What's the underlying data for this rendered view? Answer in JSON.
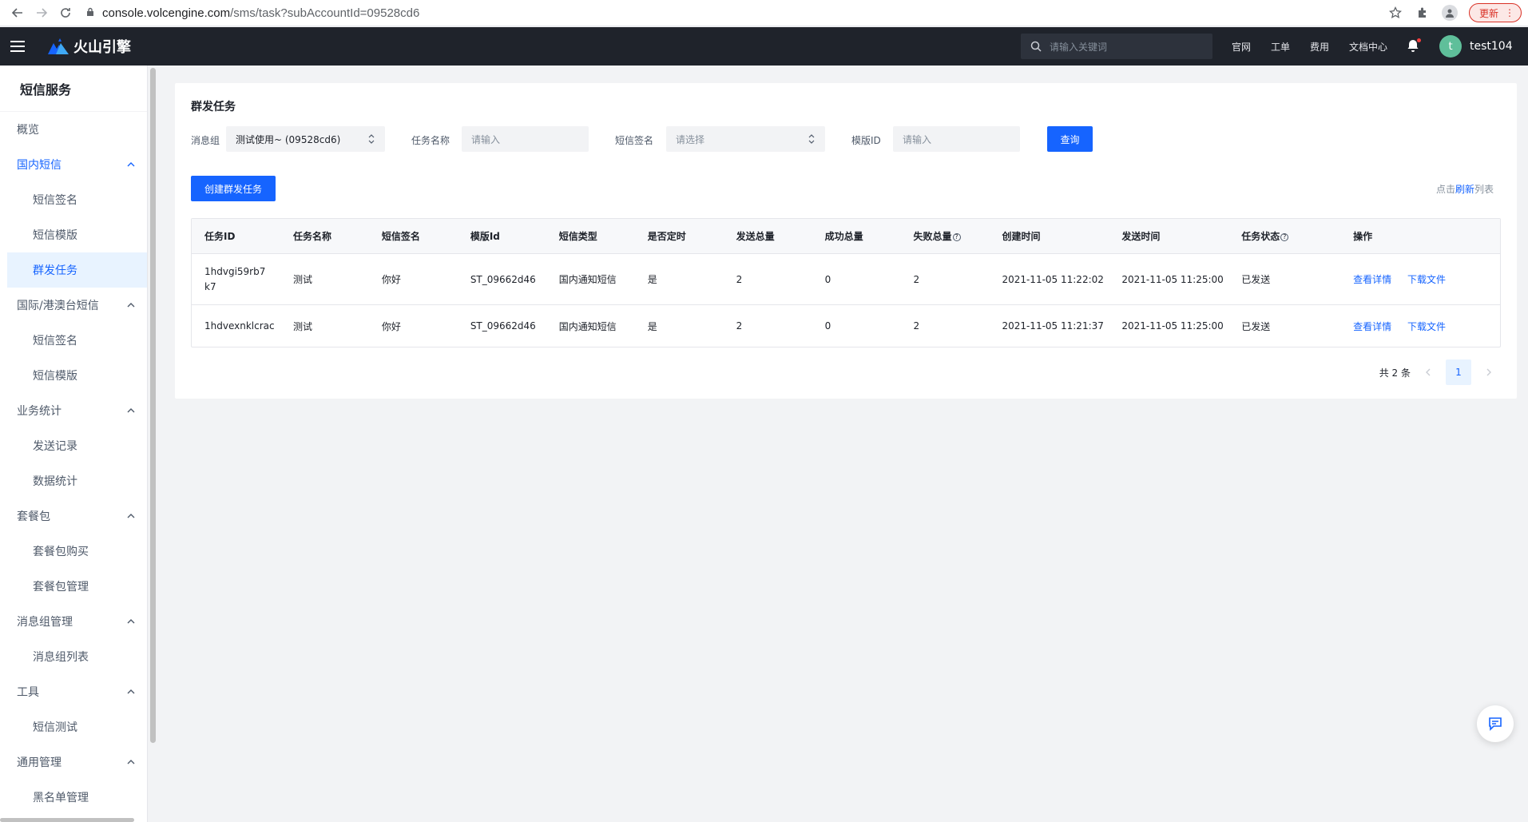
{
  "browser": {
    "url_host": "console.volcengine.com",
    "url_path": "/sms/task?subAccountId=09528cd6",
    "update_label": "更新"
  },
  "topnav": {
    "logo_text": "火山引擎",
    "search_placeholder": "请输入关键词",
    "links": [
      "官网",
      "工单",
      "费用",
      "文档中心"
    ],
    "user_initial": "t",
    "username": "test104"
  },
  "sidebar": {
    "title": "短信服务",
    "overview": "概览",
    "groups": [
      {
        "label": "国内短信",
        "items": [
          "短信签名",
          "短信模版",
          "群发任务"
        ]
      },
      {
        "label": "国际/港澳台短信",
        "items": [
          "短信签名",
          "短信模版"
        ]
      },
      {
        "label": "业务统计",
        "items": [
          "发送记录",
          "数据统计"
        ]
      },
      {
        "label": "套餐包",
        "items": [
          "套餐包购买",
          "套餐包管理"
        ]
      },
      {
        "label": "消息组管理",
        "items": [
          "消息组列表"
        ]
      },
      {
        "label": "工具",
        "items": [
          "短信测试"
        ]
      },
      {
        "label": "通用管理",
        "items": [
          "黑名单管理"
        ]
      }
    ]
  },
  "page": {
    "title": "群发任务",
    "filters": {
      "group_label": "消息组",
      "group_value": "测试使用~ (09528cd6)",
      "task_name_label": "任务名称",
      "task_name_placeholder": "请输入",
      "sign_label": "短信签名",
      "sign_placeholder": "请选择",
      "template_label": "模版ID",
      "template_placeholder": "请输入",
      "query_label": "查询"
    },
    "create_label": "创建群发任务",
    "refresh_prefix": "点击",
    "refresh_link": "刷新",
    "refresh_suffix": "列表",
    "table": {
      "headers": [
        "任务ID",
        "任务名称",
        "短信签名",
        "模版Id",
        "短信类型",
        "是否定时",
        "发送总量",
        "成功总量",
        "失败总量",
        "创建时间",
        "发送时间",
        "任务状态",
        "操作"
      ],
      "rows": [
        {
          "id": "1hdvgi59rb7k7",
          "name": "测试",
          "sign": "你好",
          "template": "ST_09662d46",
          "type": "国内通知短信",
          "scheduled": "是",
          "total": "2",
          "success": "0",
          "failed": "2",
          "created": "2021-11-05 11:22:02",
          "sent": "2021-11-05 11:25:00",
          "status": "已发送",
          "op_detail": "查看详情",
          "op_download": "下载文件"
        },
        {
          "id": "1hdvexnklcrac",
          "name": "测试",
          "sign": "你好",
          "template": "ST_09662d46",
          "type": "国内通知短信",
          "scheduled": "是",
          "total": "2",
          "success": "0",
          "failed": "2",
          "created": "2021-11-05 11:21:37",
          "sent": "2021-11-05 11:25:00",
          "status": "已发送",
          "op_detail": "查看详情",
          "op_download": "下载文件"
        }
      ]
    },
    "pagination": {
      "total_text": "共 2 条",
      "current": "1"
    }
  },
  "colors": {
    "accent": "#1664ff",
    "topnav_bg": "#1f232b"
  }
}
